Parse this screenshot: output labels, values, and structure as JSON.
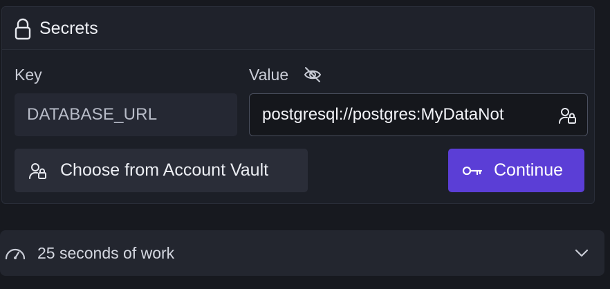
{
  "secrets": {
    "title": "Secrets",
    "header_icon": "lock-icon",
    "key_label": "Key",
    "value_label": "Value",
    "value_visibility_icon": "eye-off-icon",
    "key_value": "DATABASE_URL",
    "value_value": "postgresql://postgres:MyDataNot",
    "value_field_icon": "user-lock-icon",
    "vault_button_label": "Choose from Account Vault",
    "vault_button_icon": "user-lock-icon",
    "continue_label": "Continue",
    "continue_icon": "key-icon"
  },
  "work": {
    "label": "25 seconds of work",
    "icon": "gauge-icon",
    "expand_icon": "chevron-down-icon"
  },
  "colors": {
    "background": "#17191f",
    "card": "#1c1f27",
    "accent": "#5b3ed6"
  }
}
